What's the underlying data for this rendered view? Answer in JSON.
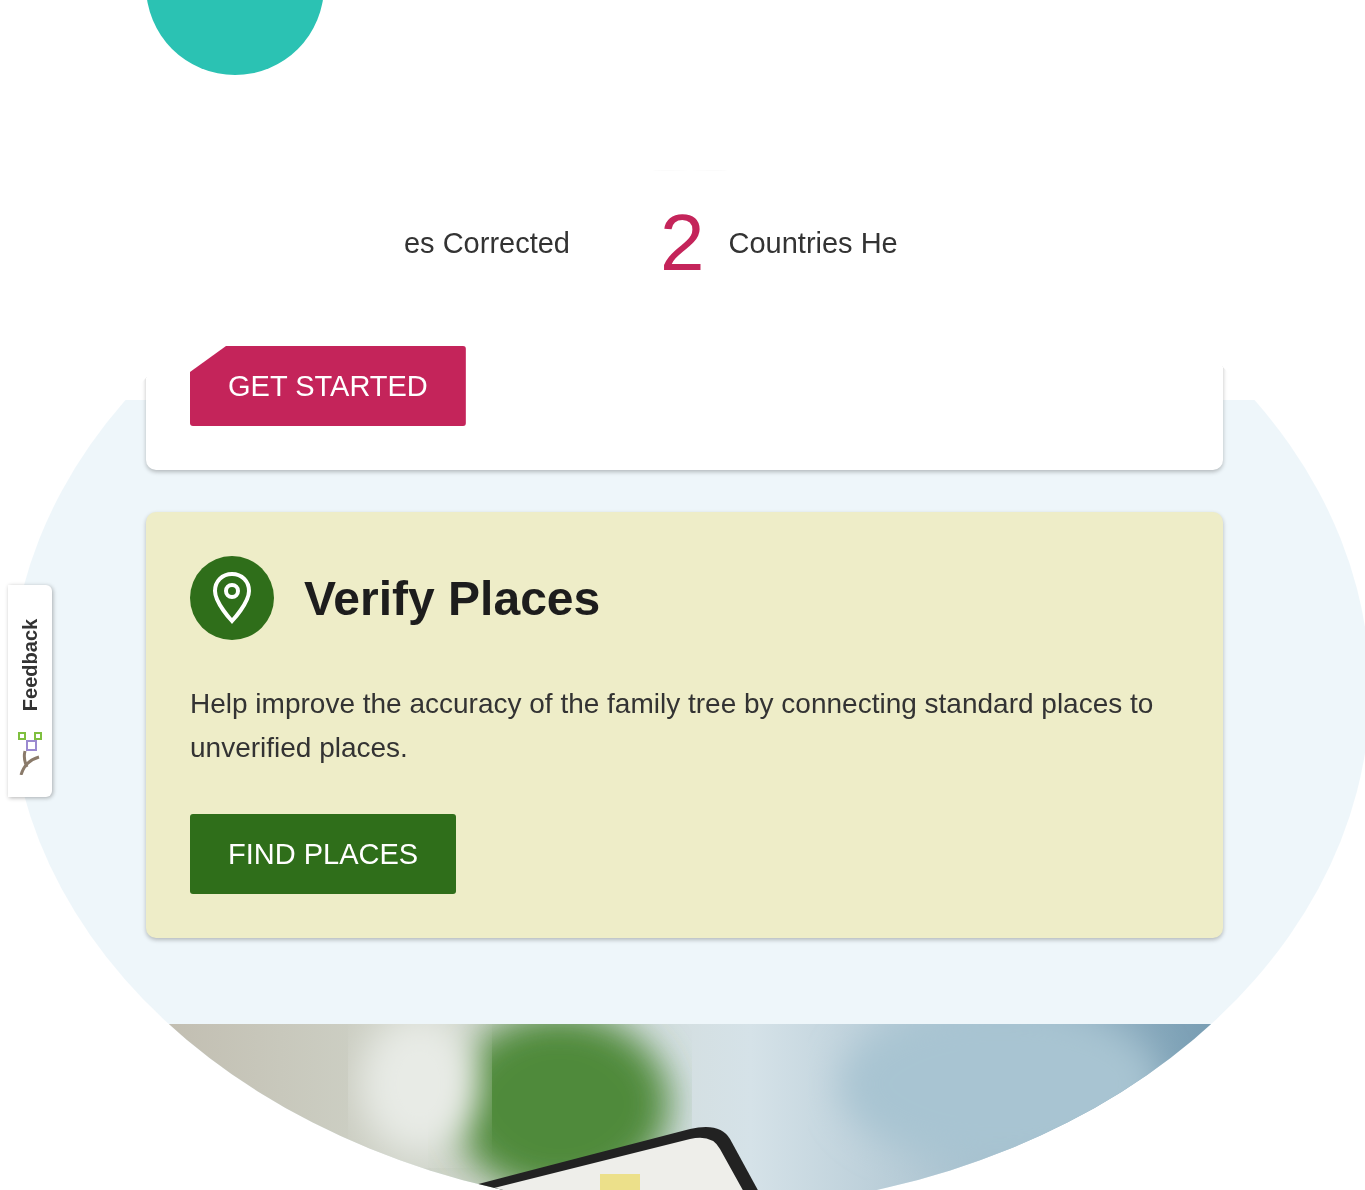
{
  "stats": [
    {
      "label": "es Corrected"
    },
    {
      "number": "2",
      "label": "Countries He"
    }
  ],
  "intro_card": {
    "button": "GET STARTED"
  },
  "task_card": {
    "title": "Verify Places",
    "description": "Help improve the accuracy of the family tree by connecting standard places to unverified places.",
    "button": "FIND PLACES"
  },
  "feedback_tab": {
    "label": "Feedback"
  }
}
